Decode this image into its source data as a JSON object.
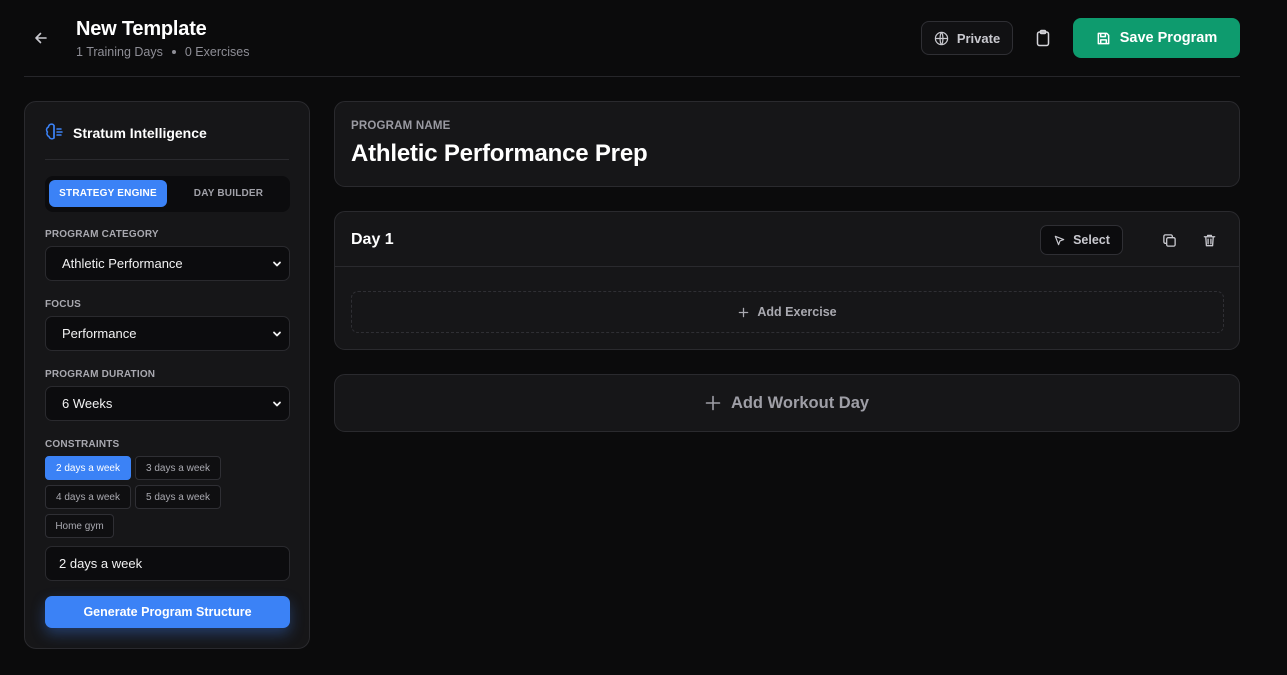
{
  "header": {
    "title": "New Template",
    "training_days": "1 Training Days",
    "exercises": "0 Exercises",
    "visibility_label": "Private",
    "save_label": "Save Program"
  },
  "sidebar": {
    "title": "Stratum Intelligence",
    "tabs": [
      {
        "label": "STRATEGY ENGINE",
        "active": true
      },
      {
        "label": "DAY BUILDER",
        "active": false
      }
    ],
    "category": {
      "label": "PROGRAM CATEGORY",
      "value": "Athletic Performance"
    },
    "focus": {
      "label": "FOCUS",
      "value": "Performance"
    },
    "duration": {
      "label": "PROGRAM DURATION",
      "value": "6 Weeks"
    },
    "constraints": {
      "label": "CONSTRAINTS",
      "chips": [
        {
          "label": "2 days a week",
          "selected": true
        },
        {
          "label": "3 days a week",
          "selected": false
        },
        {
          "label": "4 days a week",
          "selected": false
        },
        {
          "label": "5 days a week",
          "selected": false
        },
        {
          "label": "Home gym",
          "selected": false
        }
      ],
      "input_value": "2 days a week"
    },
    "generate_label": "Generate Program Structure"
  },
  "program": {
    "name_label": "PROGRAM NAME",
    "name_value": "Athletic Performance Prep"
  },
  "day": {
    "title": "Day 1",
    "select_label": "Select",
    "add_exercise_label": "Add Exercise"
  },
  "add_day_label": "Add Workout Day",
  "colors": {
    "background": "#0b0b0c",
    "card": "#161618",
    "accent_blue": "#3b82f6",
    "save_green": "#0e9b6e"
  },
  "icons": [
    "arrow-left-icon",
    "globe-icon",
    "clipboard-icon",
    "save-icon",
    "brain-icon",
    "chevron-down-icon",
    "cursor-icon",
    "copy-icon",
    "trash-icon",
    "plus-icon"
  ]
}
